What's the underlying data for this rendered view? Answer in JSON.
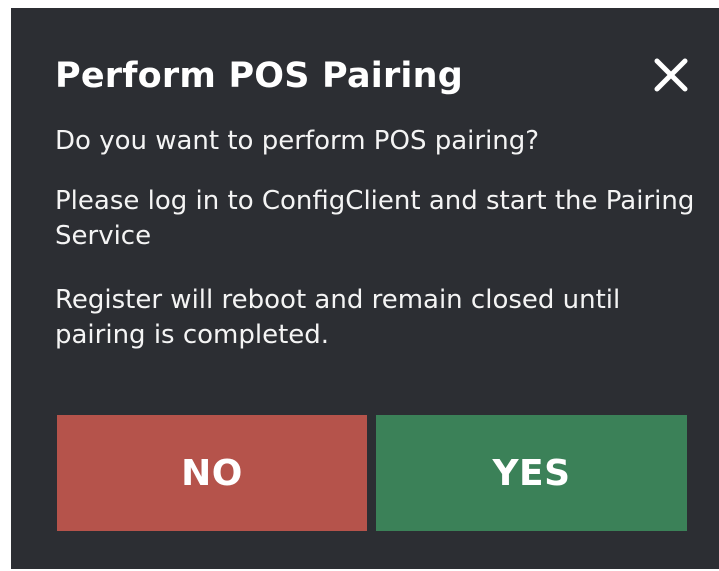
{
  "dialog": {
    "title": "Perform POS Pairing",
    "close_icon": "close-icon",
    "messages": [
      "Do you want to perform POS pairing?",
      "Please log in to ConfigClient and start the Pairing Service",
      "Register will reboot and remain closed until pairing is completed."
    ],
    "buttons": {
      "no_label": "NO",
      "yes_label": "YES"
    }
  },
  "colors": {
    "dialog_background": "#2c2e33",
    "no_button": "#b5534b",
    "yes_button": "#3b8158",
    "text": "#ffffff"
  }
}
